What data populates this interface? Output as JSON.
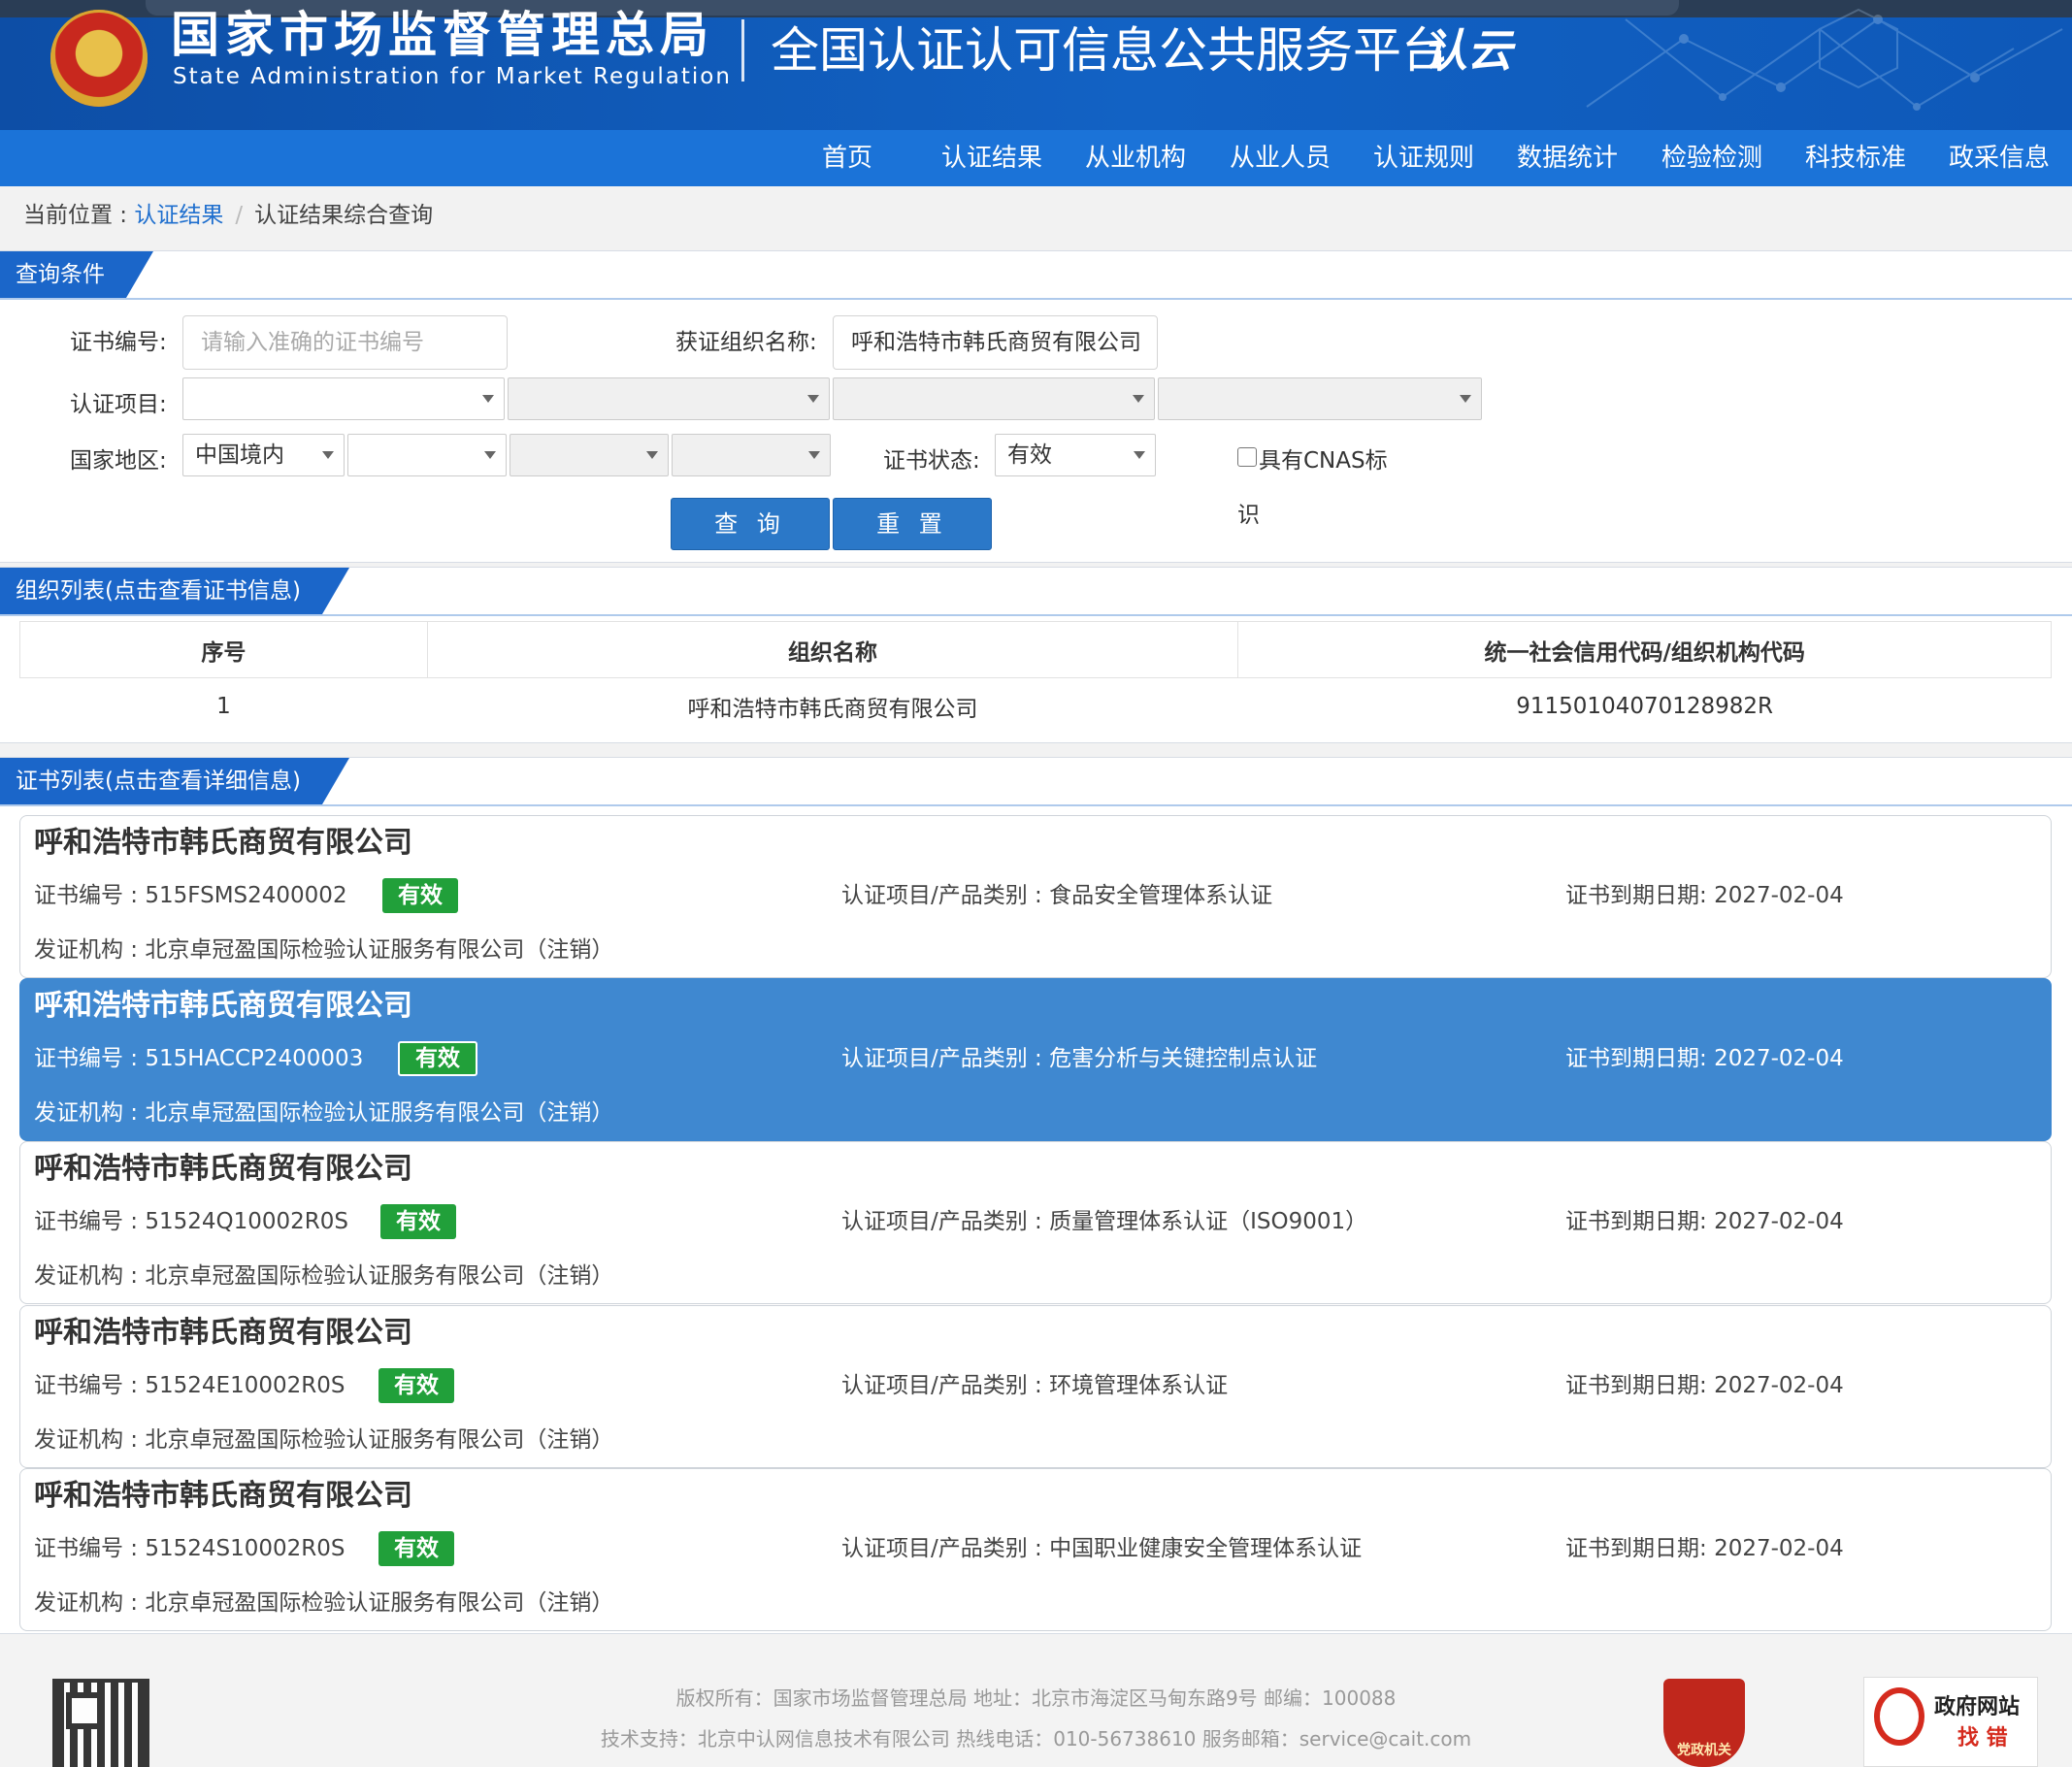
{
  "header": {
    "agency_cn": "国家市场监督管理总局",
    "agency_en": "State Administration  for  Market Regulation",
    "platform_title": "全国认证认可信息公共服务平台",
    "logo_text": "认云"
  },
  "nav": [
    "首页",
    "认证结果",
    "从业机构",
    "从业人员",
    "认证规则",
    "数据统计",
    "检验检测",
    "科技标准",
    "政采信息"
  ],
  "breadcrumb": {
    "prefix": "当前位置 : ",
    "link": "认证结果",
    "separator": "/",
    "current": "认证结果综合查询"
  },
  "query": {
    "section_title": "查询条件",
    "cert_no_label": "证书编号:",
    "cert_no_placeholder": "请输入准确的证书编号",
    "org_name_label": "获证组织名称:",
    "org_name_value": "呼和浩特市韩氏商贸有限公司",
    "project_label": "认证项目:",
    "region_label": "国家地区:",
    "region_value": "中国境内",
    "status_label": "证书状态:",
    "status_value": "有效",
    "cnas_label": "具有CNAS标",
    "cnas_label_wrap": "识",
    "search_button": "查 询",
    "reset_button": "重 置"
  },
  "org_list": {
    "section_title": "组织列表(点击查看证书信息)",
    "columns": [
      "序号",
      "组织名称",
      "统一社会信用代码/组织机构代码"
    ],
    "rows": [
      [
        "1",
        "呼和浩特市韩氏商贸有限公司",
        "91150104070128982R"
      ]
    ]
  },
  "cert_list": {
    "section_title": "证书列表(点击查看详细信息)",
    "cert_no_prefix": "证书编号 : ",
    "project_prefix": "认证项目/产品类别 : ",
    "expiry_prefix": "证书到期日期: ",
    "issuer_prefix": "发证机构 : ",
    "items": [
      {
        "org": "呼和浩特市韩氏商贸有限公司",
        "cert_no": "515FSMS2400002",
        "status": "有效",
        "project": "食品安全管理体系认证",
        "expiry": "2027-02-04",
        "issuer": "北京卓冠盈国际检验认证服务有限公司（注销）"
      },
      {
        "org": "呼和浩特市韩氏商贸有限公司",
        "cert_no": "515HACCP2400003",
        "status": "有效",
        "project": "危害分析与关键控制点认证",
        "expiry": "2027-02-04",
        "issuer": "北京卓冠盈国际检验认证服务有限公司（注销）"
      },
      {
        "org": "呼和浩特市韩氏商贸有限公司",
        "cert_no": "51524Q10002R0S",
        "status": "有效",
        "project": "质量管理体系认证（ISO9001）",
        "expiry": "2027-02-04",
        "issuer": "北京卓冠盈国际检验认证服务有限公司（注销）"
      },
      {
        "org": "呼和浩特市韩氏商贸有限公司",
        "cert_no": "51524E10002R0S",
        "status": "有效",
        "project": "环境管理体系认证",
        "expiry": "2027-02-04",
        "issuer": "北京卓冠盈国际检验认证服务有限公司（注销）"
      },
      {
        "org": "呼和浩特市韩氏商贸有限公司",
        "cert_no": "51524S10002R0S",
        "status": "有效",
        "project": "中国职业健康安全管理体系认证",
        "expiry": "2027-02-04",
        "issuer": "北京卓冠盈国际检验认证服务有限公司（注销）"
      }
    ]
  },
  "footer": {
    "line1": "版权所有：国家市场监督管理总局    地址：北京市海淀区马甸东路9号    邮编：100088",
    "line2": "技术支持：北京中认网信息技术有限公司    热线电话：010-56738610    服务邮箱：service@cait.com",
    "party_badge": "党政机关",
    "error_box_line1": "政府网站",
    "error_box_line2": "找 错"
  },
  "colors": {
    "header_blue": "#0d4ea6",
    "nav_blue": "#1b73d8",
    "active_card": "#3f88d0",
    "valid_badge": "#21a03a"
  }
}
